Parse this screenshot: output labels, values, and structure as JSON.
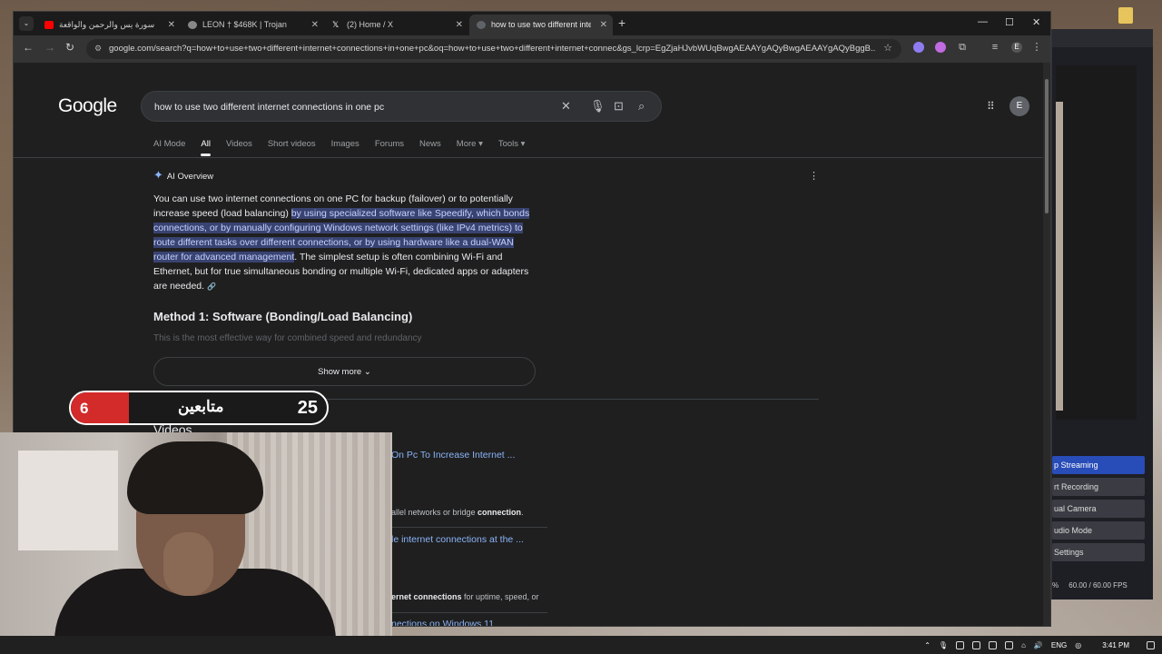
{
  "browser": {
    "tabs": [
      {
        "label": "سورة يس والرحمن والواقعة",
        "favicon_color": "#ff0000",
        "active": false
      },
      {
        "label": "LEON † $468K | Trojan",
        "favicon_color": "#888888",
        "active": false
      },
      {
        "label": "(2) Home / X",
        "favicon_color": "#ffffff",
        "active": false
      },
      {
        "label": "how to use two different intern",
        "favicon_color": "#8ab4f8",
        "active": true
      }
    ],
    "new_tab": "+",
    "url": "google.com/search?q=how+to+use+two+different+internet+connections+in+one+pc&oq=how+to+use+two+different+internet+connec&gs_lcrp=EgZjaHJvbWUqBwgAEAAYgAQyBwgAEAAYgAQyBggB...",
    "profile_initial": "E"
  },
  "search": {
    "logo": "Google",
    "query": "how to use two different internet connections in one pc",
    "tabs": [
      "AI Mode",
      "All",
      "Videos",
      "Short videos",
      "Images",
      "Forums",
      "News",
      "More ▾",
      "Tools ▾"
    ],
    "avatar_initial": "E"
  },
  "ai_overview": {
    "header": "AI Overview",
    "p1_pre": "You can use two internet connections on one PC for backup (failover) or to potentially increase speed (load balancing) ",
    "p1_highlight": "by using specialized software like Speedify, which bonds connections, or by manually configuring Windows network settings (like IPv4 metrics) to route different tasks over different connections, or by using hardware like a dual-WAN router for advanced management",
    "p1_post": ". The simplest setup is often combining Wi-Fi and Ethernet, but for true simultaneous bonding or multiple Wi-Fi, dedicated apps or adapters are needed.",
    "method_title": "Method 1: Software (Bonding/Load Balancing)",
    "method_sub": "This is the most effective way for combined speed and redundancy",
    "show_more": "Show more"
  },
  "videos": {
    "title": "Videos",
    "results": [
      {
        "kind": "link",
        "text": "On Pc To Increase Internet ..."
      },
      {
        "kind": "snip",
        "pre": "allel networks or bridge ",
        "bold": "connection",
        "post": "."
      },
      {
        "kind": "link",
        "text": "le internet connections at the ..."
      },
      {
        "kind": "snip",
        "pre": "",
        "bold": "ernet connections",
        "post": " for uptime, speed, or"
      },
      {
        "kind": "link",
        "text": "nections on Windows 11"
      }
    ]
  },
  "overlay": {
    "left_number": "6",
    "label": "متابعين",
    "right_number": "25"
  },
  "obs": {
    "buttons": [
      "p Streaming",
      "rt Recording",
      "ual Camera",
      "udio Mode",
      "Settings"
    ],
    "fps": "60.00 / 60.00 FPS",
    "percent": "%"
  },
  "taskbar": {
    "lang": "ENG",
    "time": "3:41 PM"
  },
  "colors": {
    "accent_blue": "#8ab4f8",
    "highlight": "#394371",
    "obs_primary": "#284cb8",
    "counter_red": "#d32a2a"
  }
}
